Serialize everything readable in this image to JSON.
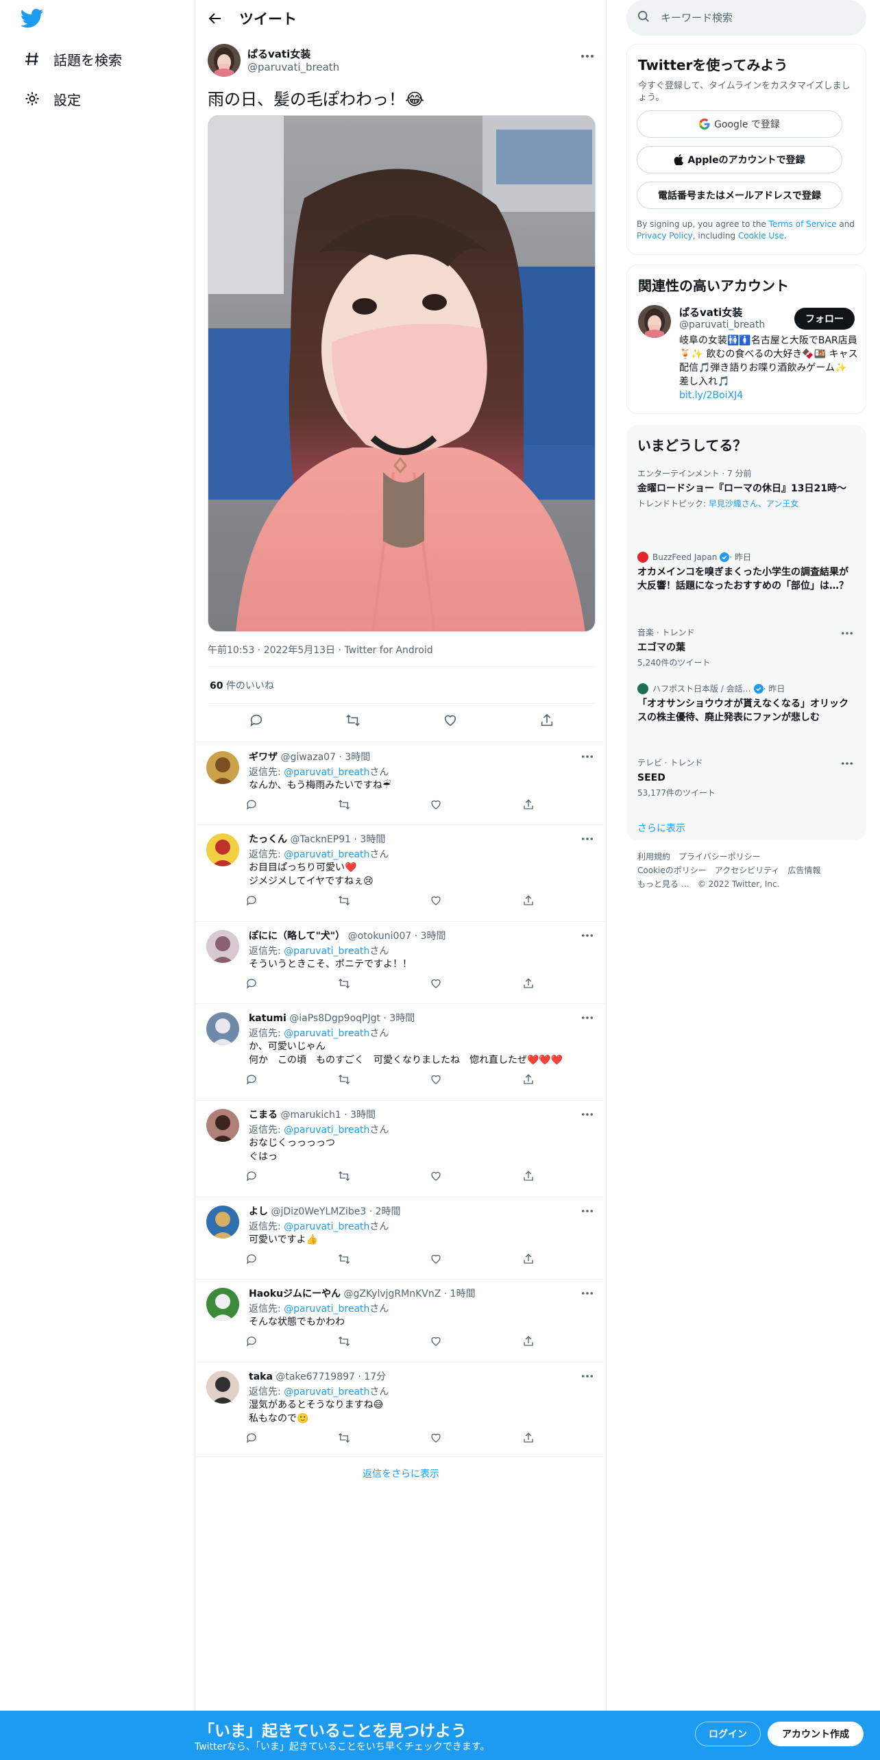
{
  "nav": {
    "explore": "話題を検索",
    "settings": "設定"
  },
  "header": {
    "title": "ツイート"
  },
  "tweet": {
    "author_name": "ぱるvati女装",
    "author_handle": "@paruvati_breath",
    "text": "雨の日、髪の毛ぽわわっ！😂",
    "meta": "午前10:53 · 2022年5月13日 · Twitter for Android",
    "like_count": "60",
    "like_label": " 件のいいね"
  },
  "replies": [
    {
      "name": "ギワザ",
      "handle": "@giwaza07",
      "time": "3時間",
      "replyto_label": "返信先: ",
      "replyto_handle": "@paruvati_breath",
      "replyto_suffix": "さん",
      "body": "なんか、もう梅雨みたいですね☔"
    },
    {
      "name": "たっくん",
      "handle": "@TacknEP91",
      "time": "3時間",
      "replyto_label": "返信先: ",
      "replyto_handle": "@paruvati_breath",
      "replyto_suffix": "さん",
      "body": "お目目ぱっちり可愛い❤️\nジメジメしてイヤですねぇ😢"
    },
    {
      "name": "ぽにに（略して\"犬\"）",
      "handle": "@otokuni007",
      "time": "3時間",
      "replyto_label": "返信先: ",
      "replyto_handle": "@paruvati_breath",
      "replyto_suffix": "さん",
      "body": "そういうときこそ、ポニテですよ！！"
    },
    {
      "name": "katumi",
      "handle": "@iaPs8Dgp9oqPJgt",
      "time": "3時間",
      "replyto_label": "返信先: ",
      "replyto_handle": "@paruvati_breath",
      "replyto_suffix": "さん",
      "body": "か、可愛いじゃん\n何か　この頃　ものすごく　可愛くなりましたね　惚れ直したぜ❤️❤️❤️"
    },
    {
      "name": "こまる",
      "handle": "@marukich1",
      "time": "3時間",
      "replyto_label": "返信先: ",
      "replyto_handle": "@paruvati_breath",
      "replyto_suffix": "さん",
      "body": "おなじくっっっっつ\nぐはっ"
    },
    {
      "name": "よし",
      "handle": "@jDiz0WeYLMZibe3",
      "time": "2時間",
      "replyto_label": "返信先: ",
      "replyto_handle": "@paruvati_breath",
      "replyto_suffix": "さん",
      "body": "可愛いですよ👍"
    },
    {
      "name": "Haokuジムにーやん",
      "handle": "@gZKylvjgRMnKVnZ",
      "time": "1時間",
      "replyto_label": "返信先: ",
      "replyto_handle": "@paruvati_breath",
      "replyto_suffix": "さん",
      "body": "そんな状態でもかわわ"
    },
    {
      "name": "taka",
      "handle": "@take67719897",
      "time": "17分",
      "replyto_label": "返信先: ",
      "replyto_handle": "@paruvati_breath",
      "replyto_suffix": "さん",
      "body": "湿気があるとそうなりますね😅\n私もなので🙂"
    }
  ],
  "show_more_replies": "返信をさらに表示",
  "search": {
    "placeholder": "キーワード検索"
  },
  "signup": {
    "title": "Twitterを使ってみよう",
    "subtitle": "今すぐ登録して、タイムラインをカスタマイズしましょう。",
    "google": "Google で登録",
    "apple": "Appleのアカウントで登録",
    "phone": "電話番号またはメールアドレスで登録",
    "legal_pre": "By signing up, you agree to the ",
    "terms": "Terms of Service",
    "legal_and": " and ",
    "privacy": "Privacy Policy",
    "legal_incl": ", including ",
    "cookie": "Cookie Use",
    "legal_end": "."
  },
  "related": {
    "title": "関連性の高いアカウント",
    "name": "ぱるvati女装",
    "handle": "@paruvati_breath",
    "follow": "フォロー",
    "bio": "岐阜の女装🚻🚺名古屋と大阪でBAR店員🍹✨ 飲むの食べるの大好き🍫🍱 キャス配信🎵弾き語りお喋り酒飲みゲーム✨ 差し入れ🎵",
    "link": "bit.ly/2BoiXJ4"
  },
  "trends": {
    "title": "いまどうしてる？",
    "items": [
      {
        "context": "エンターテインメント · 7 分前",
        "title": "金曜ロードショー『ローマの休日』13日21時〜",
        "extra_label": "トレンドトピック: ",
        "extra_value": "早見沙織さん、アン王女"
      },
      {
        "context": "BuzzFeed Japan",
        "context_suffix": " · 昨日",
        "title": "オカメインコを嗅ぎまくった小学生の調査結果が大反響！話題になったおすすめの「部位」は…？"
      },
      {
        "context": "音楽 · トレンド",
        "title": "エゴマの葉",
        "extra_label": "5,240件のツイート"
      },
      {
        "context": "ハフポスト日本版 / 会話…",
        "context_suffix": " · 昨日",
        "title": "「オオサンショウウオが貰えなくなる」オリックスの株主優待、廃止発表にファンが悲しむ"
      },
      {
        "context": "テレビ · トレンド",
        "title": "SEED",
        "extra_label": "53,177件のツイート"
      }
    ],
    "show_more": "さらに表示"
  },
  "footer": {
    "links": [
      "利用規約",
      "プライバシーポリシー",
      "Cookieのポリシー",
      "アクセシビリティ",
      "広告情報",
      "もっと見る …"
    ],
    "copyright": "© 2022 Twitter, Inc."
  },
  "bottom": {
    "title": "「いま」起きていることを見つけよう",
    "subtitle": "Twitterなら、「いま」起きていることをいち早くチェックできます。",
    "login": "ログイン",
    "signup": "アカウント作成"
  },
  "colors": {
    "accent": "#1d9bf0",
    "text": "#0f1419",
    "muted": "#536471"
  }
}
